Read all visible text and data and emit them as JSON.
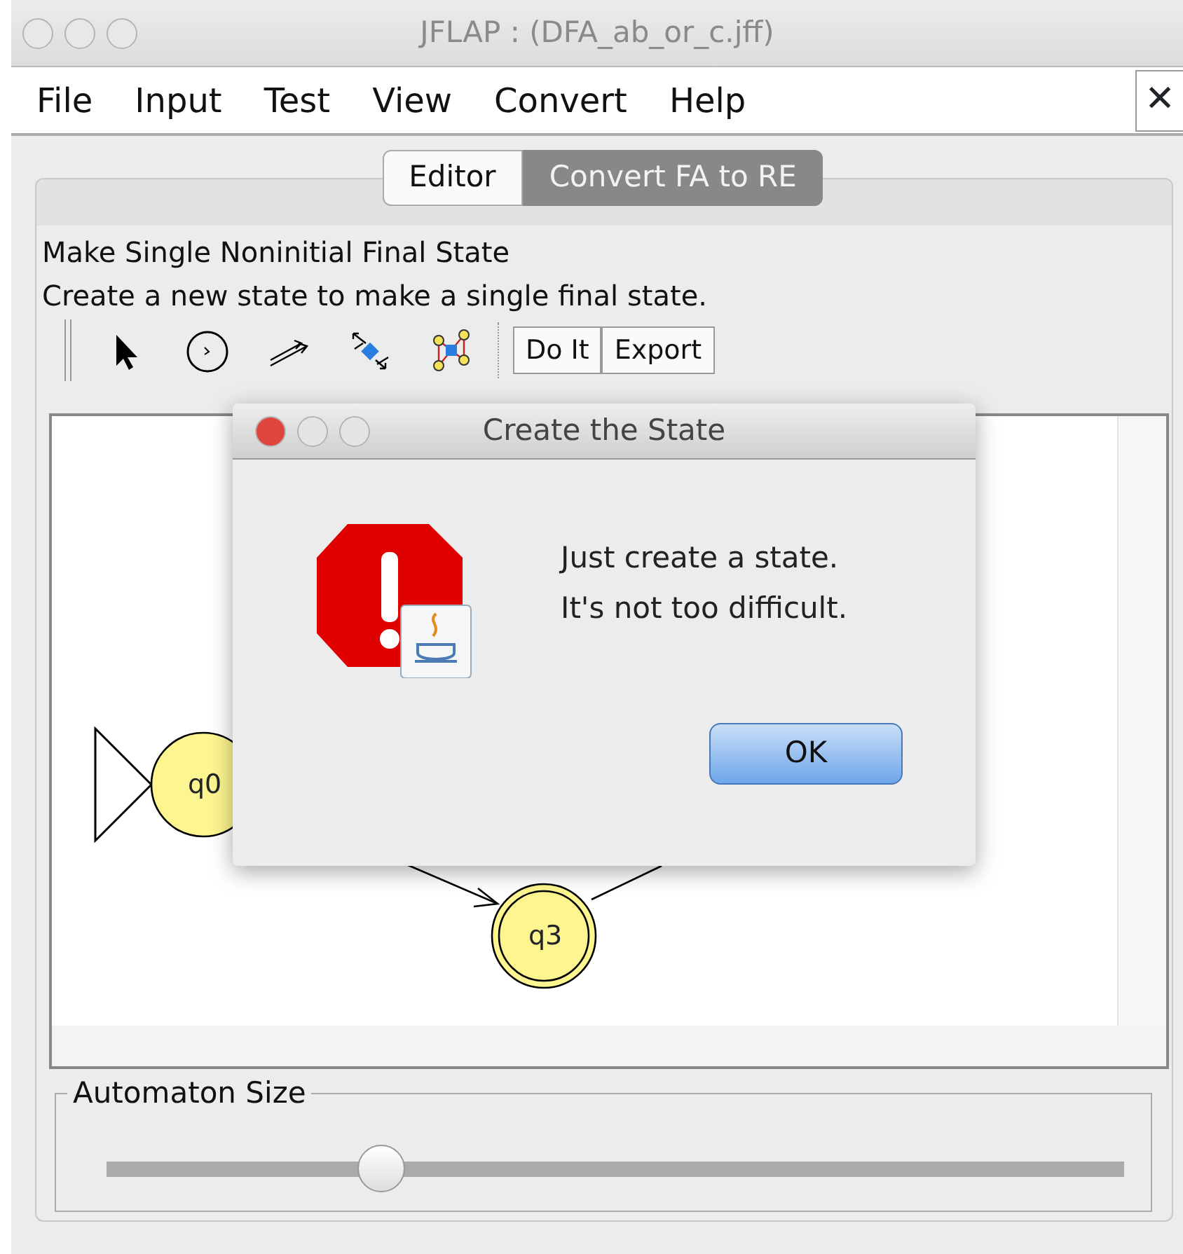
{
  "window": {
    "title": "JFLAP : (DFA_ab_or_c.jff)"
  },
  "menu_bar": {
    "items": [
      "File",
      "Input",
      "Test",
      "View",
      "Convert",
      "Help"
    ],
    "close_glyph": "✕"
  },
  "tabs": [
    {
      "label": "Editor",
      "selected": false
    },
    {
      "label": "Convert FA to RE",
      "selected": true
    }
  ],
  "step": {
    "title": "Make Single Noninitial Final State",
    "description": "Create a new state to make a single final state."
  },
  "toolbar": {
    "tools": [
      {
        "kind": "select"
      },
      {
        "kind": "state"
      },
      {
        "kind": "transition"
      },
      {
        "kind": "collapse"
      },
      {
        "kind": "group"
      }
    ],
    "buttons": [
      "Do It",
      "Export"
    ]
  },
  "canvas": {
    "states": [
      {
        "label": "q0",
        "initial": true,
        "final": false
      },
      {
        "label": "q3",
        "initial": false,
        "final": true
      }
    ]
  },
  "dialog": {
    "title": "Create the State",
    "message": [
      "Just create a state.",
      "It's not too difficult."
    ],
    "button": "OK"
  },
  "automaton_size": {
    "label": "Automaton Size",
    "level": 0.27
  }
}
